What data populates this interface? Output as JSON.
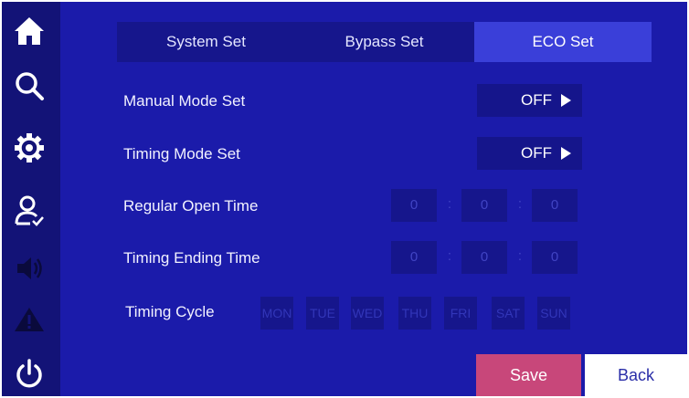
{
  "sidebar": {
    "items": [
      {
        "icon": "home-icon"
      },
      {
        "icon": "search-icon"
      },
      {
        "icon": "gear-icon"
      },
      {
        "icon": "user-icon"
      },
      {
        "icon": "speaker-icon"
      },
      {
        "icon": "warning-icon"
      },
      {
        "icon": "power-icon"
      }
    ]
  },
  "tabs": {
    "system": "System Set",
    "bypass": "Bypass Set",
    "eco": "ECO Set",
    "active": "eco"
  },
  "eco": {
    "manual_mode": {
      "label": "Manual Mode Set",
      "value": "OFF"
    },
    "timing_mode": {
      "label": "Timing Mode Set",
      "value": "OFF"
    },
    "open_time": {
      "label": "Regular Open Time",
      "h": "0",
      "m": "0",
      "s": "0"
    },
    "ending_time": {
      "label": "Timing Ending Time",
      "h": "0",
      "m": "0",
      "s": "0"
    },
    "cycle": {
      "label": "Timing Cycle",
      "days": [
        "MON",
        "TUE",
        "WED",
        "THU",
        "FRI",
        "SAT",
        "SUN"
      ]
    },
    "separator": ":"
  },
  "actions": {
    "save": "Save",
    "back": "Back"
  },
  "colors": {
    "background": "#1b1baa",
    "sidebar": "#131377",
    "active_tab": "#3a3fd9",
    "save": "#c8477a",
    "back": "#ffffff"
  }
}
